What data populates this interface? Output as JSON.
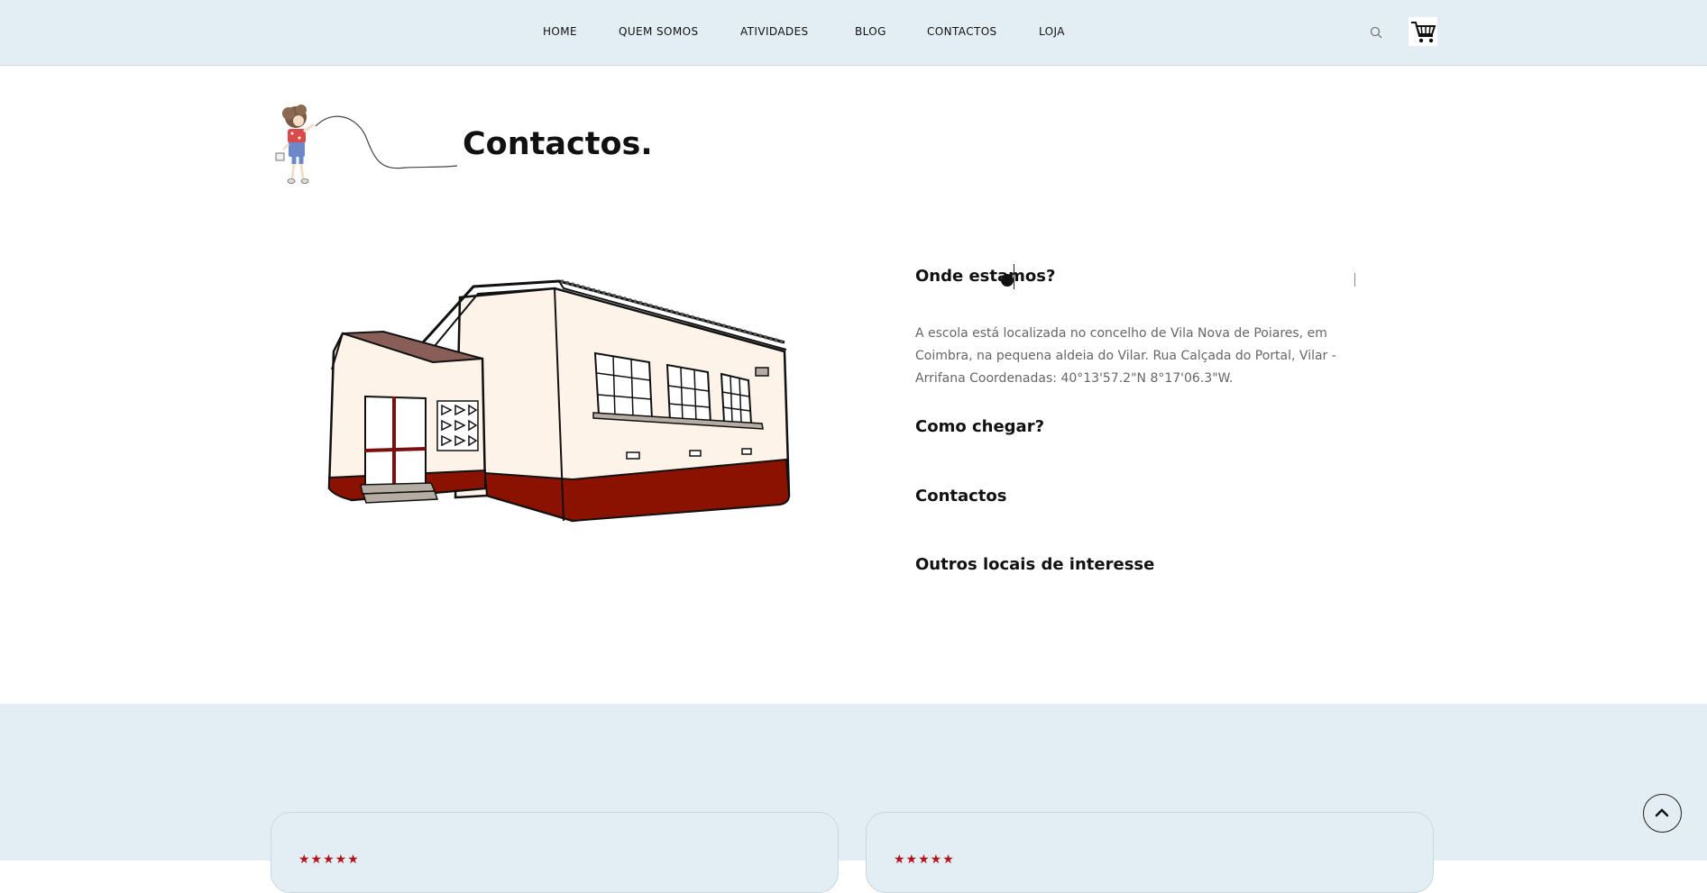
{
  "nav": {
    "items": [
      {
        "label": "HOME"
      },
      {
        "label": "QUEM SOMOS"
      },
      {
        "label": "ATIVIDADES"
      },
      {
        "label": "BLOG"
      },
      {
        "label": "CONTACTOS"
      },
      {
        "label": "LOJA"
      }
    ],
    "search_icon": "search-icon",
    "cart_icon": "cart-icon"
  },
  "hero": {
    "title": "Contactos."
  },
  "accordion": {
    "sections": [
      {
        "title": "Onde estamos?",
        "body": "A escola está localizada no concelho de Vila Nova de Poiares, em Coimbra, na pequena aldeia do Vilar. Rua Calçada do Portal, Vilar - Arrifana Coordenadas: 40°13'57.2\"N 8°17'06.3\"W.",
        "expanded": true
      },
      {
        "title": "Como chegar?",
        "expanded": false
      },
      {
        "title": "Contactos",
        "expanded": false
      },
      {
        "title": "Outros locais de interesse",
        "expanded": false
      }
    ]
  },
  "reviews": {
    "cards": [
      {
        "stars": "★★★★★"
      },
      {
        "stars": "★★★★★"
      }
    ]
  },
  "colors": {
    "header_bg": "#e2eef4",
    "star": "#b3131b",
    "school_red": "#8b1200"
  }
}
